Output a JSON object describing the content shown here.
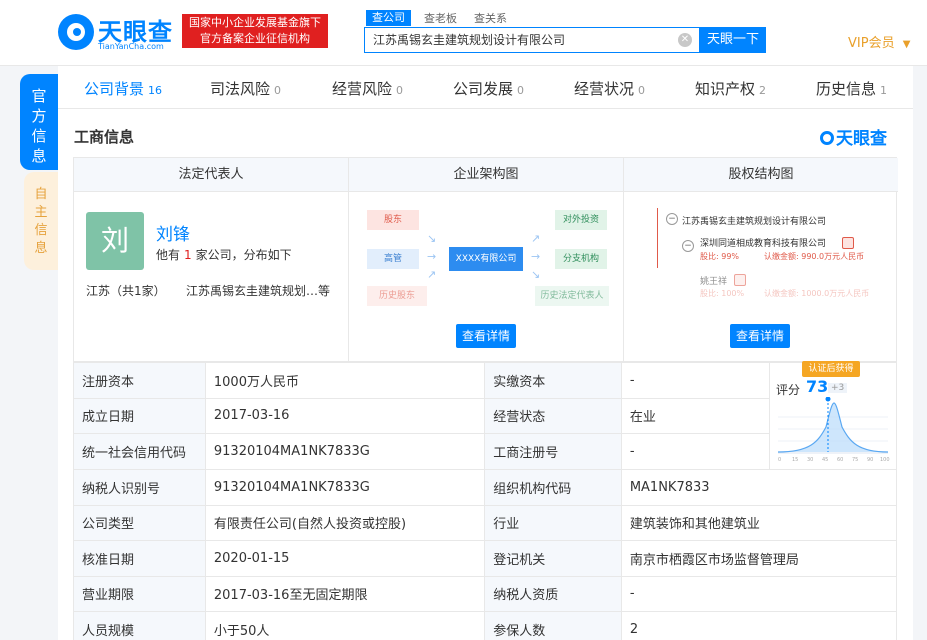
{
  "header": {
    "logo_name": "天眼查",
    "logo_sub": "TianYanCha.com",
    "badge_line1": "国家中小企业发展基金旗下",
    "badge_line2": "官方备案企业征信机构",
    "search_tabs": [
      "查公司",
      "查老板",
      "查关系"
    ],
    "search_value": "江苏禹锡玄圭建筑规划设计有限公司",
    "search_button": "天眼一下",
    "vip": "VIP会员"
  },
  "side": {
    "tab1": "官方信息",
    "tab2": "自主信息"
  },
  "nav": [
    {
      "label": "公司背景",
      "count": "16"
    },
    {
      "label": "司法风险",
      "count": "0"
    },
    {
      "label": "经营风险",
      "count": "0"
    },
    {
      "label": "公司发展",
      "count": "0"
    },
    {
      "label": "经营状况",
      "count": "0"
    },
    {
      "label": "知识产权",
      "count": "2"
    },
    {
      "label": "历史信息",
      "count": "1"
    }
  ],
  "section": {
    "title": "工商信息",
    "brand": "天眼查"
  },
  "legal": {
    "head": "法定代表人",
    "avatar_char": "刘",
    "name": "刘锋",
    "desc_pre": "他有",
    "desc_num": "1",
    "desc_post": "家公司，分布如下",
    "region": "江苏（共1家）",
    "company": "江苏禹锡玄圭建筑规划…等"
  },
  "org": {
    "head": "企业架构图",
    "shareholder": "股东",
    "executive": "高管",
    "history_shareholder": "历史股东",
    "center": "XXXX有限公司",
    "investment": "对外投资",
    "branch": "分支机构",
    "history_legal": "历史法定代表人",
    "button": "查看详情"
  },
  "equity": {
    "head": "股权结构图",
    "company": "江苏禹锡玄圭建筑规划设计有限公司",
    "holder1": "深圳同道相成教育科技有限公司",
    "holder1_ratio": "股比: 99%",
    "holder1_amount": "认缴金额: 990.0万元人民币",
    "holder2": "姚王祥",
    "holder2_ratio": "股比: 100%",
    "holder2_amount": "认缴金额: 1000.0万元人民币",
    "button": "查看详情"
  },
  "info_rows": [
    {
      "l1": "注册资本",
      "v1": "1000万人民币",
      "l2": "实缴资本",
      "v2": "-"
    },
    {
      "l1": "成立日期",
      "v1": "2017-03-16",
      "l2": "经营状态",
      "v2": "在业"
    },
    {
      "l1": "统一社会信用代码",
      "v1": "91320104MA1NK7833G",
      "l2": "工商注册号",
      "v2": "-"
    },
    {
      "l1": "纳税人识别号",
      "v1": "91320104MA1NK7833G",
      "l2": "组织机构代码",
      "v2": "MA1NK7833"
    },
    {
      "l1": "公司类型",
      "v1": "有限责任公司(自然人投资或控股)",
      "l2": "行业",
      "v2": "建筑装饰和其他建筑业"
    },
    {
      "l1": "核准日期",
      "v1": "2020-01-15",
      "l2": "登记机关",
      "v2": "南京市栖霞区市场监督管理局"
    },
    {
      "l1": "营业期限",
      "v1": "2017-03-16至无固定期限",
      "l2": "纳税人资质",
      "v2": "-"
    },
    {
      "l1": "人员规模",
      "v1": "小于50人",
      "l2": "参保人数",
      "v2": "2"
    }
  ],
  "score": {
    "badge": "认证后获得",
    "label": "评分",
    "value": "73",
    "plus": "+3",
    "axis_ticks": [
      "0",
      "15",
      "30",
      "45",
      "60",
      "75",
      "90",
      "100"
    ]
  },
  "colors": {
    "primary": "#0084ff",
    "badge_red": "#e02020",
    "vip_gold": "#e9a02b",
    "avatar_green": "#7fc3a7"
  }
}
